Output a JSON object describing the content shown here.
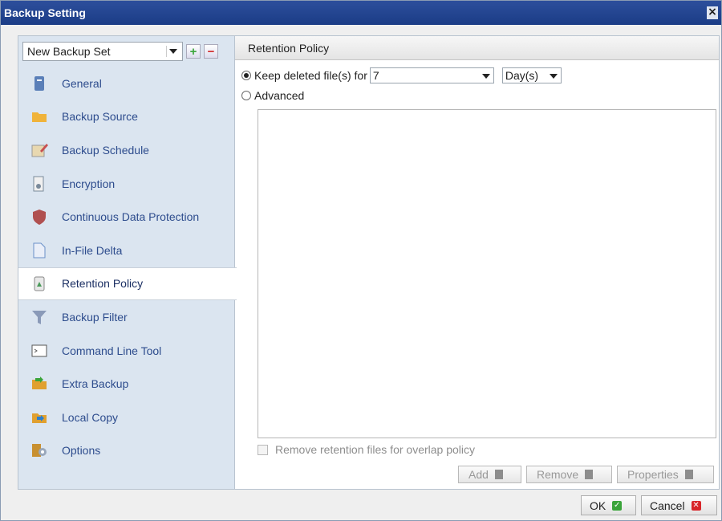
{
  "window": {
    "title": "Backup Setting",
    "close_glyph": "×"
  },
  "backup_set": {
    "selected": "New Backup Set",
    "add_glyph": "+",
    "remove_glyph": "−"
  },
  "sidebar": {
    "items": [
      {
        "label": "General",
        "icon": "document-icon",
        "color": "#5a7fb8"
      },
      {
        "label": "Backup Source",
        "icon": "folder-open-icon",
        "color": "#f0b33a"
      },
      {
        "label": "Backup Schedule",
        "icon": "calendar-pen-icon",
        "color": "#c85050"
      },
      {
        "label": "Encryption",
        "icon": "key-document-icon",
        "color": "#7a8a9a"
      },
      {
        "label": "Continuous Data Protection",
        "icon": "shield-icon",
        "color": "#b05050"
      },
      {
        "label": "In-File Delta",
        "icon": "file-delta-icon",
        "color": "#6a90c8"
      },
      {
        "label": "Retention Policy",
        "icon": "recycle-bin-icon",
        "color": "#4a9a5a"
      },
      {
        "label": "Backup Filter",
        "icon": "funnel-icon",
        "color": "#8a9ab8"
      },
      {
        "label": "Command Line Tool",
        "icon": "terminal-icon",
        "color": "#555555"
      },
      {
        "label": "Extra Backup",
        "icon": "folder-arrow-icon",
        "color": "#e0a030"
      },
      {
        "label": "Local Copy",
        "icon": "folder-copy-icon",
        "color": "#e0a030"
      },
      {
        "label": "Options",
        "icon": "gear-icon",
        "color": "#c89030"
      }
    ],
    "active_index": 6
  },
  "panel": {
    "title": "Retention Policy",
    "keep_label": "Keep deleted file(s) for",
    "keep_value": "7",
    "unit": "Day(s)",
    "advanced_label": "Advanced",
    "remove_overlap_label": "Remove retention files for overlap policy",
    "add_label": "Add",
    "remove_label": "Remove",
    "properties_label": "Properties"
  },
  "footer": {
    "ok_label": "OK",
    "cancel_label": "Cancel"
  }
}
